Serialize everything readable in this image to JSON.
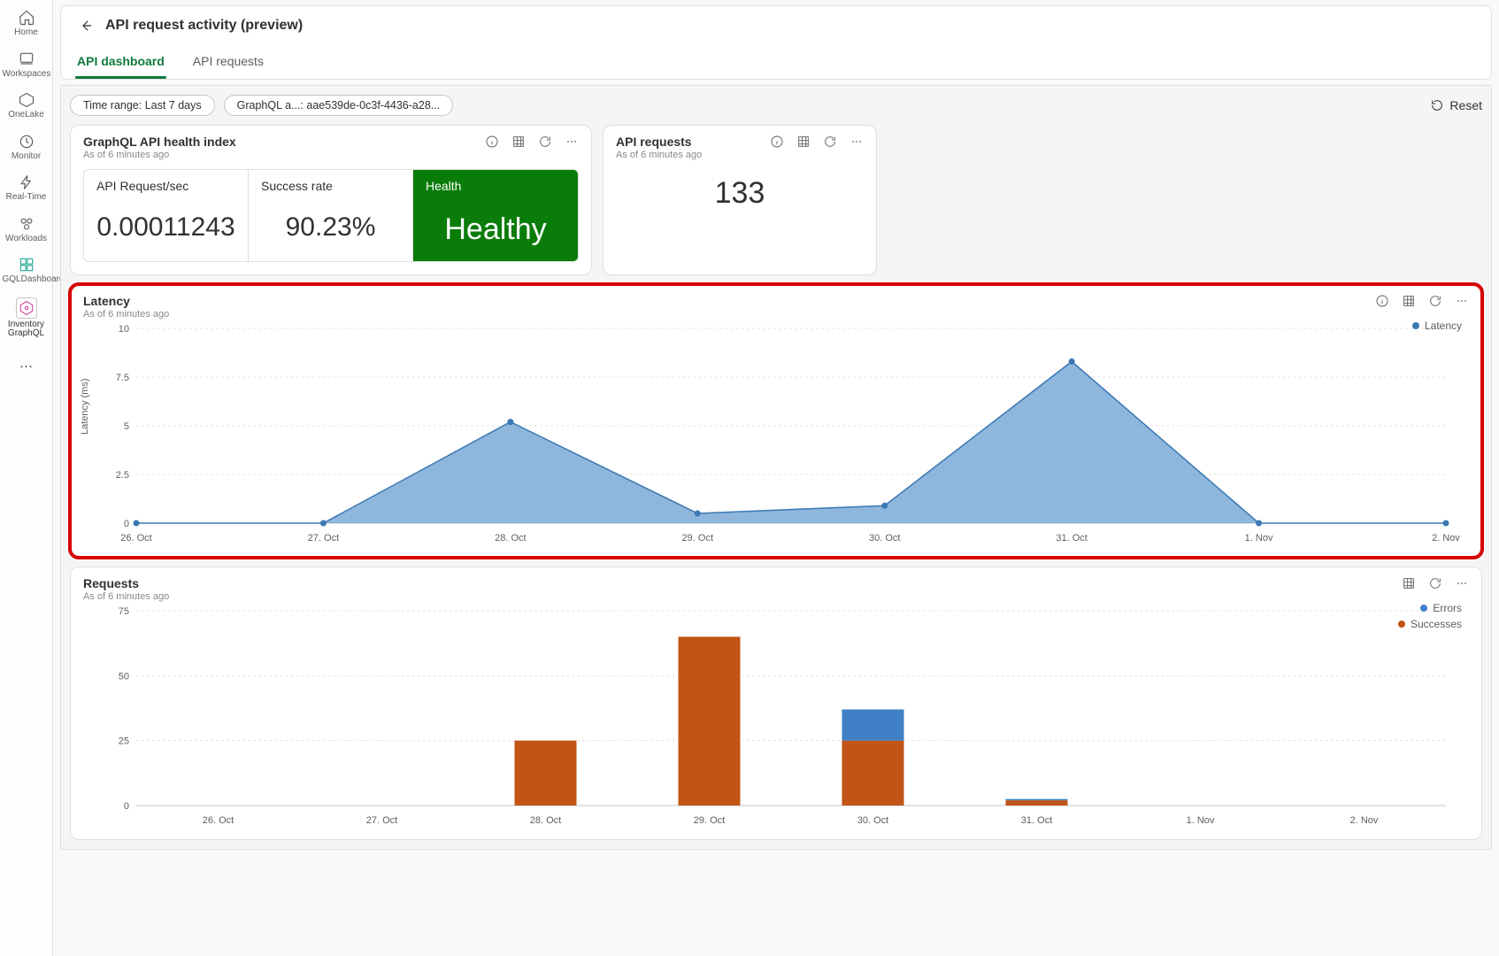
{
  "sidebar": {
    "items": [
      {
        "label": "Home",
        "icon": "home"
      },
      {
        "label": "Workspaces",
        "icon": "workspaces"
      },
      {
        "label": "OneLake",
        "icon": "onelake"
      },
      {
        "label": "Monitor",
        "icon": "monitor"
      },
      {
        "label": "Real-Time",
        "icon": "realtime"
      },
      {
        "label": "Workloads",
        "icon": "workloads"
      },
      {
        "label": "GQLDashboard",
        "icon": "gqldashboard"
      },
      {
        "label": "Inventory GraphQL",
        "icon": "inventory"
      }
    ],
    "ellipsis": "…"
  },
  "header": {
    "title": "API request activity (preview)",
    "tabs": [
      {
        "label": "API dashboard",
        "active": true
      },
      {
        "label": "API requests",
        "active": false
      }
    ]
  },
  "filters": {
    "time_range_label": "Time range: Last 7 days",
    "graphql_label": "GraphQL a...: aae539de-0c3f-4436-a28...",
    "reset_label": "Reset"
  },
  "cards": {
    "health": {
      "title": "GraphQL API health index",
      "subtitle": "As of 6 minutes ago",
      "kpis": {
        "req_sec_label": "API Request/sec",
        "req_sec_value": "0.00011243",
        "success_label": "Success rate",
        "success_value": "90.23%",
        "health_label": "Health",
        "health_value": "Healthy"
      }
    },
    "api_requests": {
      "title": "API requests",
      "subtitle": "As of 6 minutes ago",
      "value": "133"
    },
    "latency": {
      "title": "Latency",
      "subtitle": "As of 6 minutes ago",
      "legend": "Latency"
    },
    "requests_chart": {
      "title": "Requests",
      "subtitle": "As of 6 minutes ago",
      "legend_errors": "Errors",
      "legend_successes": "Successes"
    }
  },
  "colors": {
    "area_blue": "#6a9dd0",
    "line_blue": "#3a78b3",
    "bar_orange": "#c25417",
    "bar_blue": "#3f80c7",
    "green": "#0a7c0a"
  },
  "chart_data": [
    {
      "id": "latency",
      "type": "area",
      "title": "Latency",
      "xlabel": "",
      "ylabel": "Latency (ms)",
      "ylim": [
        0,
        10
      ],
      "yticks": [
        0,
        2.5,
        5,
        7.5,
        10
      ],
      "categories": [
        "26. Oct",
        "27. Oct",
        "28. Oct",
        "29. Oct",
        "30. Oct",
        "31. Oct",
        "1. Nov",
        "2. Nov"
      ],
      "series": [
        {
          "name": "Latency",
          "color": "#6a9dd0",
          "values": [
            0,
            0,
            5.2,
            0.5,
            0.9,
            8.3,
            0,
            0
          ]
        }
      ],
      "legend_position": "top-right"
    },
    {
      "id": "requests",
      "type": "bar",
      "title": "Requests",
      "xlabel": "",
      "ylabel": "",
      "ylim": [
        0,
        75
      ],
      "yticks": [
        0,
        25,
        50,
        75
      ],
      "categories": [
        "26. Oct",
        "27. Oct",
        "28. Oct",
        "29. Oct",
        "30. Oct",
        "31. Oct",
        "1. Nov",
        "2. Nov"
      ],
      "series": [
        {
          "name": "Successes",
          "color": "#c25417",
          "values": [
            0,
            0,
            25,
            65,
            25,
            2,
            0,
            0
          ]
        },
        {
          "name": "Errors",
          "color": "#3f80c7",
          "values": [
            0,
            0,
            0,
            0,
            12,
            0.5,
            0,
            0
          ]
        }
      ],
      "stacked": true,
      "legend_position": "top-right"
    }
  ]
}
